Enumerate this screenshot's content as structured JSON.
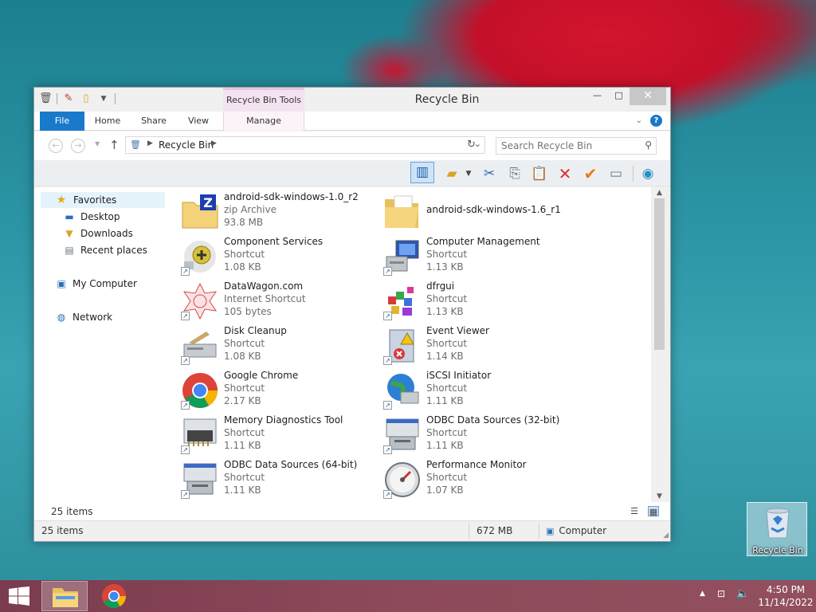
{
  "window": {
    "title": "Recycle Bin",
    "context_tab_group": "Recycle Bin Tools",
    "minimize_glyph": "—",
    "maximize_glyph": "□",
    "close_glyph": "✕"
  },
  "ribbon": {
    "tabs": [
      {
        "label": "File"
      },
      {
        "label": "Home"
      },
      {
        "label": "Share"
      },
      {
        "label": "View"
      },
      {
        "label": "Manage"
      }
    ],
    "help_glyph": "?"
  },
  "address": {
    "path": [
      "Recycle Bin"
    ],
    "search_placeholder": "Search Recycle Bin"
  },
  "toolbar": {
    "buttons": [
      "preview-pane",
      "new-folder",
      "cut",
      "copy",
      "paste",
      "delete",
      "restore",
      "rename",
      "properties"
    ]
  },
  "nav_pane": {
    "favorites": {
      "label": "Favorites"
    },
    "favorite_items": [
      {
        "label": "Desktop"
      },
      {
        "label": "Downloads"
      },
      {
        "label": "Recent places"
      }
    ],
    "my_computer": {
      "label": "My Computer"
    },
    "network": {
      "label": "Network"
    }
  },
  "files": [
    {
      "name": "android-sdk-windows-1.0_r2",
      "type": "zip Archive",
      "size": "93.8 MB",
      "icon": "zip-archive-icon"
    },
    {
      "name": "android-sdk-windows-1.6_r1",
      "type": "",
      "size": "",
      "icon": "folder-icon"
    },
    {
      "name": "Component Services",
      "type": "Shortcut",
      "size": "1.08 KB",
      "icon": "component-services-icon"
    },
    {
      "name": "Computer Management",
      "type": "Shortcut",
      "size": "1.13 KB",
      "icon": "computer-management-icon"
    },
    {
      "name": "DataWagon.com",
      "type": "Internet Shortcut",
      "size": "105 bytes",
      "icon": "internet-shortcut-icon"
    },
    {
      "name": "dfrgui",
      "type": "Shortcut",
      "size": "1.13 KB",
      "icon": "defrag-icon"
    },
    {
      "name": "Disk Cleanup",
      "type": "Shortcut",
      "size": "1.08 KB",
      "icon": "disk-cleanup-icon"
    },
    {
      "name": "Event Viewer",
      "type": "Shortcut",
      "size": "1.14 KB",
      "icon": "event-viewer-icon"
    },
    {
      "name": "Google Chrome",
      "type": "Shortcut",
      "size": "2.17 KB",
      "icon": "chrome-icon"
    },
    {
      "name": "iSCSI Initiator",
      "type": "Shortcut",
      "size": "1.11 KB",
      "icon": "iscsi-icon"
    },
    {
      "name": "Memory Diagnostics Tool",
      "type": "Shortcut",
      "size": "1.11 KB",
      "icon": "memory-diagnostics-icon"
    },
    {
      "name": "ODBC Data Sources (32-bit)",
      "type": "Shortcut",
      "size": "1.11 KB",
      "icon": "odbc-icon"
    },
    {
      "name": "ODBC Data Sources (64-bit)",
      "type": "Shortcut",
      "size": "1.11 KB",
      "icon": "odbc-icon"
    },
    {
      "name": "Performance Monitor",
      "type": "Shortcut",
      "size": "1.07 KB",
      "icon": "performance-monitor-icon"
    }
  ],
  "status": {
    "inner_count": "25 items",
    "count": "25 items",
    "size": "672 MB",
    "location": "Computer"
  },
  "desktop": {
    "recycle_bin_label": "Recycle Bin"
  },
  "taskbar": {
    "apps": [
      "file-explorer",
      "google-chrome"
    ],
    "time": "4:50 PM",
    "date": "11/14/2022"
  },
  "colors": {
    "file_tab": "#1979ca",
    "context_tab": "#f3e3f0",
    "taskbar": "#8d4a5a",
    "nav_selected": "#e5f3fb"
  }
}
